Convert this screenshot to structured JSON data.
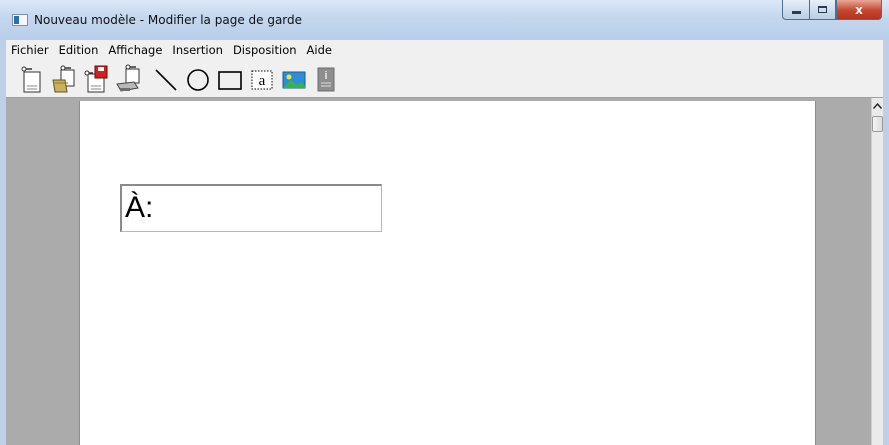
{
  "window": {
    "title": "Nouveau modèle - Modifier la page de garde",
    "caption_buttons": {
      "minimize_icon": "minimize-icon",
      "maximize_icon": "maximize-icon",
      "close_icon": "close-icon",
      "close_glyph": "x"
    }
  },
  "menu": {
    "items": [
      "Fichier",
      "Edition",
      "Affichage",
      "Insertion",
      "Disposition",
      "Aide"
    ]
  },
  "toolbar": {
    "tools": [
      {
        "icon": "new-document-icon"
      },
      {
        "icon": "open-folder-icon"
      },
      {
        "icon": "save-icon"
      },
      {
        "icon": "print-icon"
      },
      {
        "icon": "line-tool-icon"
      },
      {
        "icon": "ellipse-tool-icon"
      },
      {
        "icon": "rectangle-tool-icon"
      },
      {
        "icon": "text-tool-icon",
        "label": "a"
      },
      {
        "icon": "image-tool-icon"
      },
      {
        "icon": "info-field-icon",
        "label": "i"
      }
    ]
  },
  "canvas": {
    "text_field_value": "À:"
  },
  "colors": {
    "titlebar": "#c4d7ee",
    "close_button": "#c4462e",
    "workspace": "#ababab",
    "page": "#ffffff"
  }
}
